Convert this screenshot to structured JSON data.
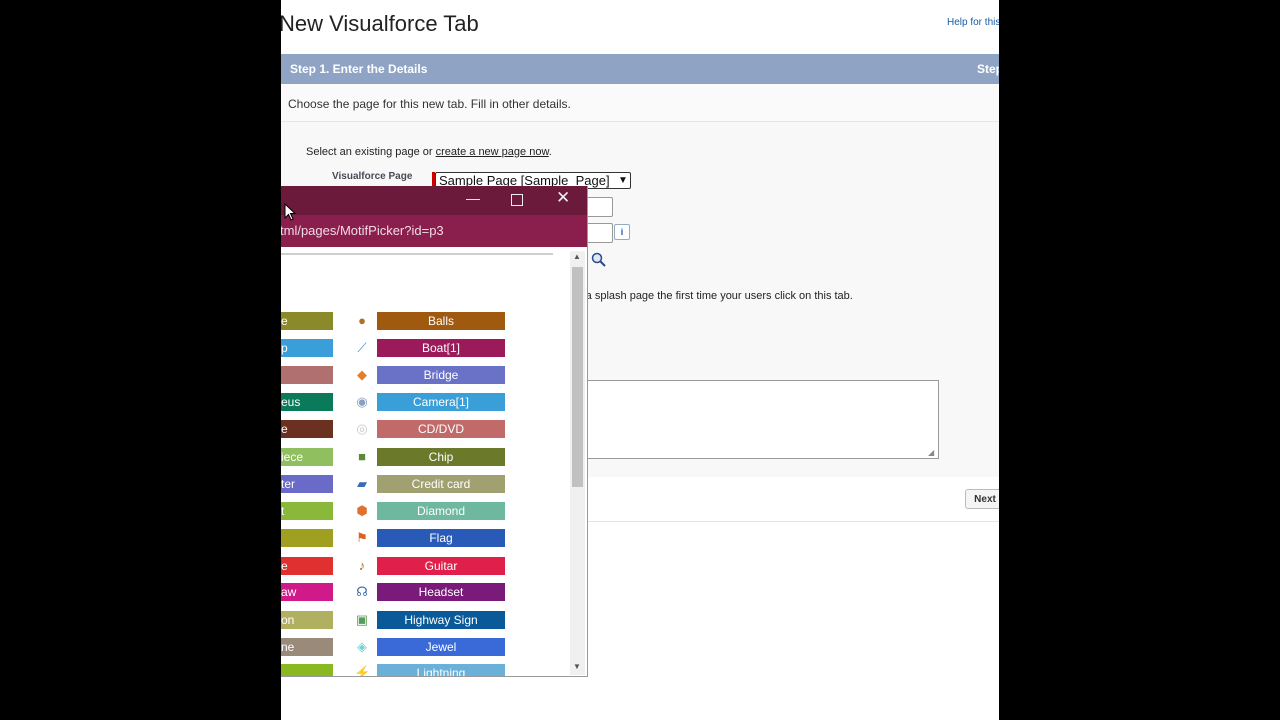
{
  "page": {
    "title": "New Visualforce Tab",
    "help_link": "Help for this",
    "step_title": "Step 1. Enter the Details",
    "step_right": "Step",
    "intro": "Choose the page for this new tab. Fill in other details.",
    "select_text": "Select an existing page or ",
    "create_link": "create a new page now",
    "select_text_end": ".",
    "vf_label": "Visualforce Page",
    "vf_select_value": "Sample Page [Sample_Page]",
    "info_icon": "i",
    "splash_text": "as a splash page the first time your users click on this tab.",
    "next_label": "Next"
  },
  "popup": {
    "url": "tml/pages/MotifPicker?id=p3",
    "minimize": "—",
    "close": "✕",
    "left_column": [
      {
        "label": "e",
        "color": "#8a8a2a"
      },
      {
        "label": "p",
        "color": "#3a9fd8"
      },
      {
        "label": "",
        "color": "#b07070"
      },
      {
        "label": "eus",
        "color": "#0a7a5a"
      },
      {
        "label": "e",
        "color": "#6a3020"
      },
      {
        "label": "iece",
        "color": "#8fbf5f"
      },
      {
        "label": "ter",
        "color": "#6a6ac8"
      },
      {
        "label": "t",
        "color": "#8ab83a"
      },
      {
        "label": "",
        "color": "#a0a020"
      },
      {
        "label": "e",
        "color": "#e03030"
      },
      {
        "label": "aw",
        "color": "#d01a8a"
      },
      {
        "label": "on",
        "color": "#b0b060"
      },
      {
        "label": "ne",
        "color": "#9a8a7a"
      },
      {
        "label": "",
        "color": "#8ab820"
      }
    ],
    "right_column": [
      {
        "label": "Balls",
        "color": "#a05a10",
        "icon": "●",
        "icon_color": "#b0702a"
      },
      {
        "label": "Boat[1]",
        "color": "#9a1a5a",
        "icon": "⟋",
        "icon_color": "#4a8ac8"
      },
      {
        "label": "Bridge",
        "color": "#6a72c8",
        "icon": "◆",
        "icon_color": "#e0802a"
      },
      {
        "label": "Camera[1]",
        "color": "#3a9fd8",
        "icon": "◉",
        "icon_color": "#8aa0c0"
      },
      {
        "label": "CD/DVD",
        "color": "#c06a6a",
        "icon": "◎",
        "icon_color": "#c8c8c8"
      },
      {
        "label": "Chip",
        "color": "#6a7a2a",
        "icon": "■",
        "icon_color": "#5a8a3a"
      },
      {
        "label": "Credit card",
        "color": "#a0a070",
        "icon": "▰",
        "icon_color": "#3a6ab8"
      },
      {
        "label": "Diamond",
        "color": "#6fb8a0",
        "icon": "⬢",
        "icon_color": "#e07030"
      },
      {
        "label": "Flag",
        "color": "#2a5ab8",
        "icon": "⚑",
        "icon_color": "#e06020"
      },
      {
        "label": "Guitar",
        "color": "#e0204a",
        "icon": "♪",
        "icon_color": "#a07020"
      },
      {
        "label": "Headset",
        "color": "#7a1a7a",
        "icon": "☊",
        "icon_color": "#3a6aa8"
      },
      {
        "label": "Highway Sign",
        "color": "#0a5a9a",
        "icon": "▣",
        "icon_color": "#5a9a5a"
      },
      {
        "label": "Jewel",
        "color": "#3a6ad8",
        "icon": "◈",
        "icon_color": "#7ad0d0"
      },
      {
        "label": "Lightning",
        "color": "#6ab0d8",
        "icon": "⚡",
        "icon_color": "#e0b040"
      }
    ]
  }
}
